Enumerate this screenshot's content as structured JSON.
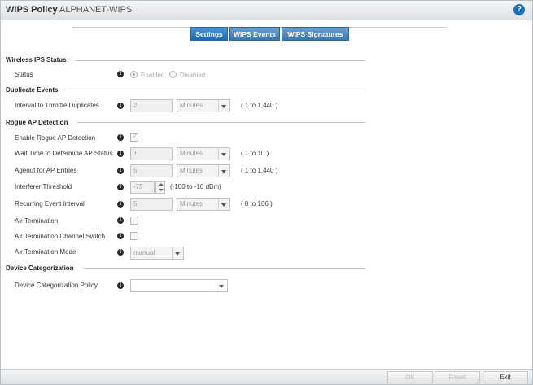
{
  "header": {
    "title": "WIPS Policy",
    "subtitle": "ALPHANET-WIPS",
    "help_icon": "?"
  },
  "tabs": [
    {
      "label": "Settings",
      "active": true
    },
    {
      "label": "WIPS Events",
      "active": false
    },
    {
      "label": "WIPS Signatures",
      "active": false
    }
  ],
  "sections": {
    "wireless_ips_status": "Wireless IPS Status",
    "duplicate_events": "Duplicate Events",
    "rogue_ap_detection": "Rogue AP Detection",
    "device_categorization": "Device Categorization"
  },
  "info_icon": "i",
  "fields": {
    "status": {
      "label": "Status",
      "options": [
        "Enabled",
        "Disabled"
      ],
      "selected": "Enabled"
    },
    "interval_throttle": {
      "label": "Interval to Throttle Duplicates",
      "value": "2",
      "unit": "Minutes",
      "range": "( 1 to 1,440 )"
    },
    "enable_rogue": {
      "label": "Enable Rogue AP Detection",
      "checked": true,
      "check_glyph": "✓"
    },
    "wait_time": {
      "label": "Wait Time to Determine AP Status",
      "value": "1",
      "unit": "Minutes",
      "range": "( 1 to 10 )"
    },
    "ageout": {
      "label": "Ageout for AP Entries",
      "value": "5",
      "unit": "Minutes",
      "range": "( 1 to 1,440 )"
    },
    "interferer": {
      "label": "Interferer Threshold",
      "value": "-75",
      "range": "(-100 to -10 dBm)"
    },
    "recurring": {
      "label": "Recurring Event Interval",
      "value": "5",
      "unit": "Minutes",
      "range": "( 0 to 166 )"
    },
    "air_termination": {
      "label": "Air Termination",
      "checked": false
    },
    "air_term_channel": {
      "label": "Air Termination Channel Switch",
      "checked": false
    },
    "air_term_mode": {
      "label": "Air Termination Mode",
      "value": "manual"
    },
    "device_cat_policy": {
      "label": "Device Categorization Policy",
      "value": ""
    }
  },
  "footer": {
    "ok": "OK",
    "reset": "Reset",
    "exit": "Exit"
  }
}
